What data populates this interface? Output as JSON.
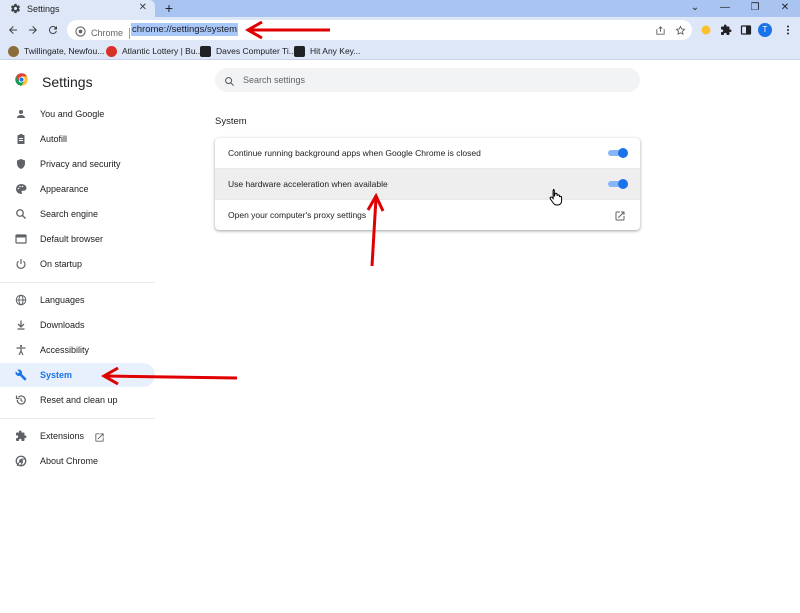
{
  "browser": {
    "tab_title": "Settings",
    "newtab_label": "+",
    "omnibox": {
      "chip_label": "Chrome",
      "url": "chrome://settings/system"
    },
    "profile_initial": "T",
    "bookmarks": [
      {
        "label": "Twillingate, Newfou...",
        "color": "#8a6d3b"
      },
      {
        "label": "Atlantic Lottery | Bu...",
        "color": "#d93025"
      },
      {
        "label": "Daves Computer Ti...",
        "color": "#202124"
      },
      {
        "label": "Hit Any Key...",
        "color": "#202124"
      }
    ]
  },
  "settings": {
    "title": "Settings",
    "search": {
      "placeholder": "Search settings"
    },
    "nav": {
      "group1": [
        {
          "label": "You and Google",
          "icon": "person-icon"
        },
        {
          "label": "Autofill",
          "icon": "clipboard-icon"
        },
        {
          "label": "Privacy and security",
          "icon": "shield-icon"
        },
        {
          "label": "Appearance",
          "icon": "palette-icon"
        },
        {
          "label": "Search engine",
          "icon": "search-icon"
        },
        {
          "label": "Default browser",
          "icon": "browser-icon"
        },
        {
          "label": "On startup",
          "icon": "power-icon"
        }
      ],
      "group2": [
        {
          "label": "Languages",
          "icon": "globe-icon"
        },
        {
          "label": "Downloads",
          "icon": "download-icon"
        },
        {
          "label": "Accessibility",
          "icon": "accessibility-icon"
        },
        {
          "label": "System",
          "icon": "wrench-icon",
          "active": true
        },
        {
          "label": "Reset and clean up",
          "icon": "history-icon"
        }
      ],
      "group3": [
        {
          "label": "Extensions",
          "icon": "puzzle-icon"
        },
        {
          "label": "About Chrome",
          "icon": "chrome-icon"
        }
      ]
    },
    "system": {
      "section_title": "System",
      "rows": [
        {
          "label": "Continue running background apps when Google Chrome is closed",
          "toggle": true
        },
        {
          "label": "Use hardware acceleration when available",
          "toggle": true
        },
        {
          "label": "Open your computer's proxy settings",
          "toggle": null
        }
      ]
    }
  },
  "colors": {
    "accent": "#1a73e8",
    "annotation_arrow": "#e00000"
  }
}
